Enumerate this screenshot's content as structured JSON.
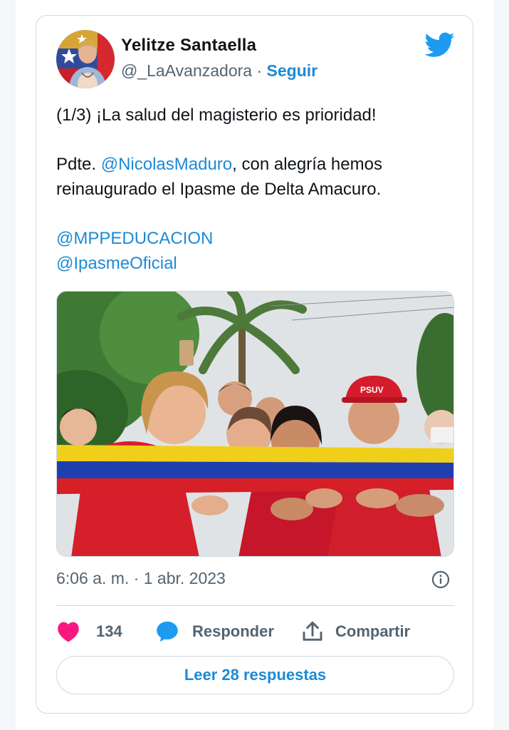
{
  "author": {
    "name": "Yelitze Santaella",
    "handle": "@_LaAvanzadora",
    "separator": "·",
    "follow_label": "Seguir"
  },
  "tweet": {
    "line1": "(1/3) ¡La salud del magisterio es prioridad!",
    "p2_prefix": "Pdte. ",
    "p2_mention": "@NicolasMaduro",
    "p2_suffix": ", con alegría hemos",
    "p2_line2": "reinaugurado el Ipasme de Delta Amacuro.",
    "mention_1": "@MPPEDUCACION",
    "mention_2": "@IpasmeOficial"
  },
  "photo": {
    "cap_text": "PSUV"
  },
  "meta": {
    "timestamp": "6:06 a. m. · 1 abr. 2023"
  },
  "actions": {
    "like_count": "134",
    "reply_label": "Responder",
    "share_label": "Compartir"
  },
  "footer": {
    "read_replies_label": "Leer 28 respuestas"
  },
  "icons": {
    "brand": "twitter-bird-icon",
    "like": "heart-icon",
    "reply": "speech-bubble-icon",
    "share": "upload-icon",
    "info": "info-icon"
  },
  "colors": {
    "link_blue": "#1d8ad6",
    "twitter_blue": "#1d9bf0",
    "heart_pink": "#f91880",
    "text": "#0f1419",
    "muted": "#536471",
    "border": "#cfd9de"
  }
}
